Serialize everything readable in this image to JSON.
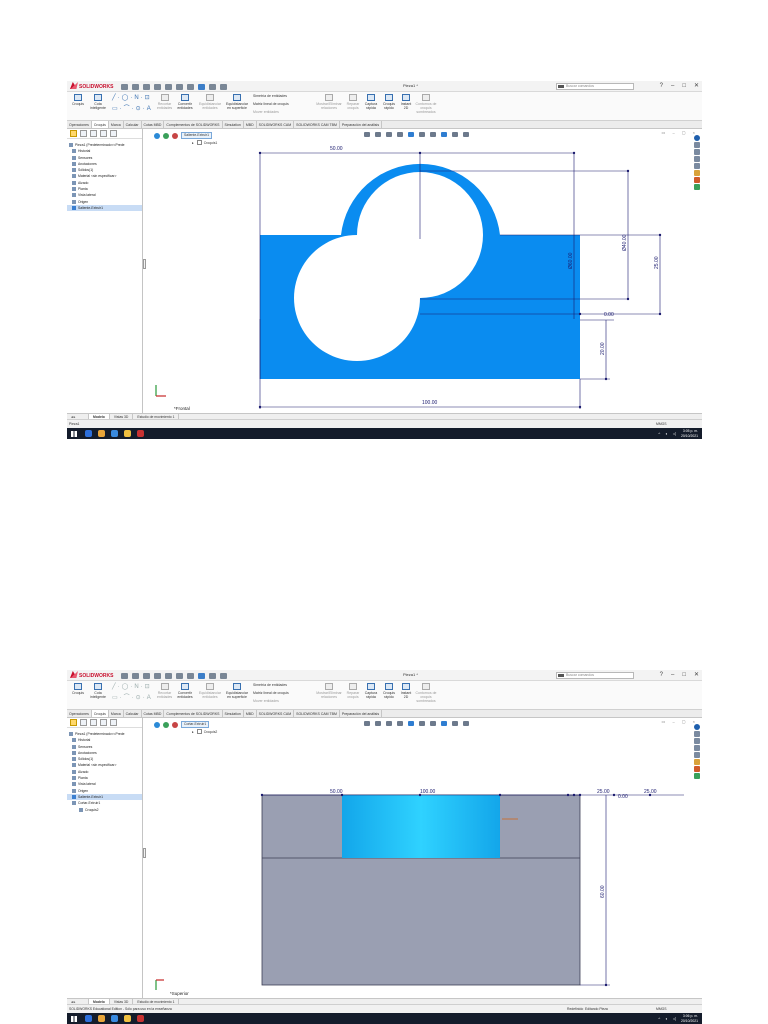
{
  "app": {
    "brand": "SOLIDWORKS",
    "doc_title": "Pieza1 *",
    "search_placeholder": "Buscar comandos",
    "window_controls": [
      "?",
      "–",
      "□",
      "✕"
    ]
  },
  "ribbon": {
    "buttons": [
      {
        "label": "Croquis",
        "dim": false
      },
      {
        "label": "Cota inteligente",
        "dim": false
      },
      {
        "label": "Recortar entidades",
        "dim": true
      },
      {
        "label": "Convertir entidades",
        "dim": false
      },
      {
        "label": "Equidistanciar entidades",
        "dim": true
      },
      {
        "label": "Equidistanciar en superficie",
        "dim": false
      },
      {
        "label": "Simetría de entidades",
        "dim": false
      },
      {
        "label": "Matriz lineal de croquis",
        "dim": false
      },
      {
        "label": "Mover entidades",
        "dim": true
      },
      {
        "label": "Mostrar/Eliminar relaciones",
        "dim": true
      },
      {
        "label": "Reparar croquis",
        "dim": true
      },
      {
        "label": "Captura rápida",
        "dim": false
      },
      {
        "label": "Croquis rápido",
        "dim": false
      },
      {
        "label": "Instant 2D",
        "dim": false
      },
      {
        "label": "Contornos de croquis sombreados",
        "dim": true
      }
    ]
  },
  "tabs": [
    "Operaciones",
    "Croquis",
    "Marca",
    "Calcular",
    "Cotas MBD",
    "Complementos de SOLIDWORKS",
    "Simulation",
    "MBD",
    "SOLIDWORKS CAM",
    "SOLIDWORKS CAM TBM",
    "Preparación del análisis"
  ],
  "active_tab": "Croquis",
  "bottom_tabs": [
    "Modelo",
    "Vistas 3D",
    "Estudio de movimiento 1"
  ],
  "view_labels": {
    "front": "*Frontal",
    "top": "*Superior"
  },
  "screen1": {
    "tree": [
      {
        "label": "Pieza1  (Predeterminado<<Prede",
        "level": "root",
        "hl": false
      },
      {
        "label": "Historial",
        "level": "item",
        "hl": false
      },
      {
        "label": "Sensores",
        "level": "item",
        "hl": false
      },
      {
        "label": "Anotaciones",
        "level": "item",
        "hl": false
      },
      {
        "label": "Sólidos(1)",
        "level": "item",
        "hl": false
      },
      {
        "label": "Material <sin especificar>",
        "level": "item",
        "hl": false
      },
      {
        "label": "Alzado",
        "level": "item",
        "hl": false
      },
      {
        "label": "Planta",
        "level": "item",
        "hl": false
      },
      {
        "label": "Vista lateral",
        "level": "item",
        "hl": false
      },
      {
        "label": "Origen",
        "level": "item",
        "hl": false
      },
      {
        "label": "Saliente-Extruir1",
        "level": "item",
        "hl": true
      }
    ],
    "confirm_label": "Saliente-Extruir1",
    "breadcrumb": "Croquis1",
    "dimensions": {
      "top_width": "50.00",
      "diameter_outer": "Ø60.00",
      "diameter_inner": "Ø40.00",
      "height_center": "25.00",
      "center_gap": "0.00",
      "base_height": "20.00",
      "overall_width": "100.00"
    },
    "status_left": "Pieza1",
    "status_units": "MMGS",
    "tray_time": "3:05 p. m.",
    "tray_date": "20/10/2021"
  },
  "screen2": {
    "tree": [
      {
        "label": "Pieza1  (Predeterminado<<Prede",
        "level": "root",
        "hl": false
      },
      {
        "label": "Historial",
        "level": "item",
        "hl": false
      },
      {
        "label": "Sensores",
        "level": "item",
        "hl": false
      },
      {
        "label": "Anotaciones",
        "level": "item",
        "hl": false
      },
      {
        "label": "Sólidos(1)",
        "level": "item",
        "hl": false
      },
      {
        "label": "Material <sin especificar>",
        "level": "item",
        "hl": false
      },
      {
        "label": "Alzado",
        "level": "item",
        "hl": false
      },
      {
        "label": "Planta",
        "level": "item",
        "hl": false
      },
      {
        "label": "Vista lateral",
        "level": "item",
        "hl": false
      },
      {
        "label": "Origen",
        "level": "item",
        "hl": false
      },
      {
        "label": "Saliente-Extruir1",
        "level": "item",
        "hl": true
      },
      {
        "label": "Cortar-Extruir1",
        "level": "item",
        "hl": false
      },
      {
        "label": "Croquis2",
        "level": "sub",
        "hl": false
      }
    ],
    "confirm_label": "Cortar-Extruir1",
    "breadcrumb": "Croquis2",
    "dimensions": {
      "left_width": "50.00",
      "center_width": "100.00",
      "right_a": "25.00",
      "right_b": "25.00",
      "right_c": "0.00",
      "depth": "60.00"
    },
    "status_left": "SOLIDWORKS Educational Edition - Sólo para uso en la enseñanza",
    "status_r1": "Redefinido",
    "status_r2": "Editando Pieza",
    "status_units": "MMGS",
    "tray_time": "3:06 p. m.",
    "tray_date": "20/10/2021"
  },
  "colors": {
    "sketch_fill": "#0a8cf0",
    "body_gray": "#9a9fb2",
    "cut_cyan": "#19b4f0",
    "dimension_line": "#1a1a6e"
  }
}
